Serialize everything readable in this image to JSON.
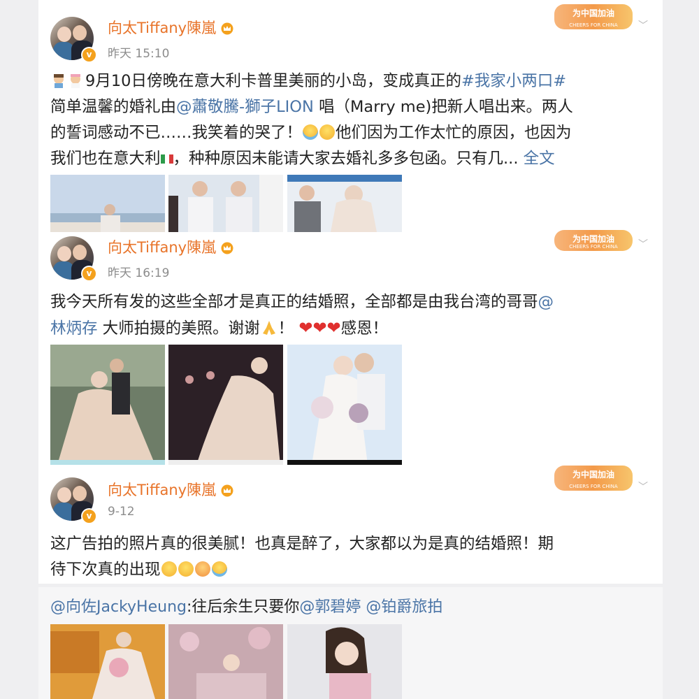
{
  "posts": [
    {
      "username": "向太Tiffany陳嵐",
      "time": "昨天 15:10",
      "promo": {
        "title": "为中国加油",
        "sub": "CHEERS FOR CHINA"
      },
      "text_parts": [
        {
          "t": "9月10日傍晚在意大利卡普里美丽的小岛，变成真正的"
        },
        {
          "t": "#我家小两口#",
          "link": true
        },
        {
          "t": "\n简单温馨的婚礼由"
        },
        {
          "t": "@蕭敬騰-獅子LION",
          "link": true
        },
        {
          "t": " 唱（Marry me)把新人唱出来。两人\n的誓词感动不已……我笑着的哭了！"
        },
        {
          "emoji": "cry-laugh-icon"
        },
        {
          "emoji": "laugh-icon"
        },
        {
          "t": "他们因为工作太忙的原因，也因为\n我们也在意大利"
        },
        {
          "emoji": "italy-flag-icon"
        },
        {
          "t": "，种种原因未能请大家去婚礼多多包函。只有几... "
        },
        {
          "t": "全文",
          "link": true
        }
      ]
    },
    {
      "username": "向太Tiffany陳嵐",
      "time": "昨天 16:19",
      "promo": {
        "title": "为中国加油",
        "sub": "CHEERS FOR CHINA"
      },
      "text_parts": [
        {
          "t": "我今天所有发的这些全部才是真正的结婚照，全部都是由我台湾的哥哥"
        },
        {
          "t": "@\n林炳存",
          "link": true
        },
        {
          "t": " 大师拍摄的美照。谢谢"
        },
        {
          "emoji": "pray-icon"
        },
        {
          "t": "！ "
        },
        {
          "emoji": "heart-icon"
        },
        {
          "emoji": "heart-icon"
        },
        {
          "emoji": "heart-icon"
        },
        {
          "t": "感恩！"
        }
      ]
    },
    {
      "username": "向太Tiffany陳嵐",
      "time": "9-12",
      "promo": {
        "title": "为中国加油",
        "sub": "CHEERS FOR CHINA"
      },
      "text_parts": [
        {
          "t": "这广告拍的照片真的很美腻！也真是醉了，大家都以为是真的结婚照！期\n待下次真的出现"
        },
        {
          "emoji": "laugh-icon"
        },
        {
          "emoji": "laugh-icon"
        },
        {
          "emoji": "kiss-icon"
        },
        {
          "emoji": "cry-laugh-icon"
        }
      ]
    }
  ],
  "shared": {
    "parts": [
      {
        "t": "@向佐JackyHeung",
        "link": true
      },
      {
        "t": ":往后余生只要你"
      },
      {
        "t": "@郭碧婷",
        "link": true
      },
      {
        "t": " "
      },
      {
        "t": "@铂爵旅拍",
        "link": true
      }
    ]
  },
  "colors": {
    "username": "#e8742a",
    "link": "#4a74a6",
    "time": "#8c8c8c",
    "badge": "#f4a11d"
  }
}
